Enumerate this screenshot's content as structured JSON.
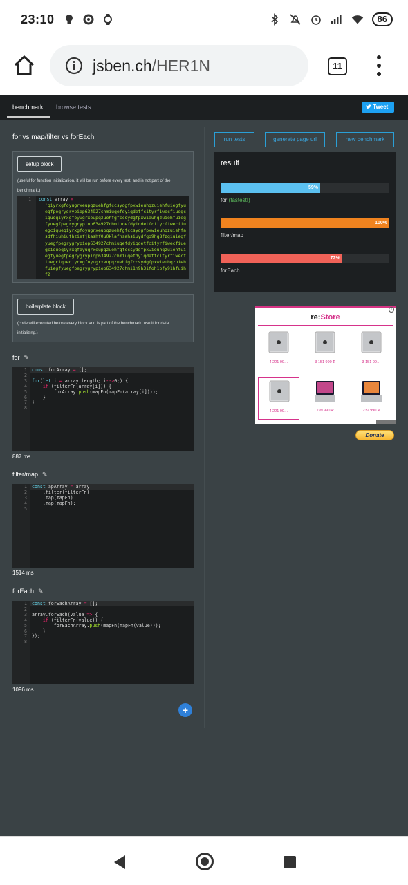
{
  "status_bar": {
    "time": "23:10",
    "battery": "86",
    "icons": [
      "bulb-icon",
      "refresh-icon",
      "watch-icon",
      "bluetooth-icon",
      "mute-icon",
      "alarm-icon",
      "signal-icon",
      "wifi-icon"
    ]
  },
  "browser": {
    "url_domain": "jsben.ch",
    "url_path": "/HER1N",
    "tab_count": "11"
  },
  "topnav": {
    "tabs": [
      {
        "label": "benchmark",
        "active": true
      },
      {
        "label": "browse tests",
        "active": false
      }
    ],
    "tweet_label": "Tweet"
  },
  "title": "for vs map/filter vs forEach",
  "setup": {
    "button": "setup block",
    "note": "(useful for function initialization. it will be run before every test, and is not part of the benchmark.)",
    "line_numbers": "1",
    "first_line": "const array = ",
    "string_content": "'qiyrxgfoyugrxeupqzuehfgfccsydgfpxwieuhqzuiehfuiegfyuegfpegrygrypiop634927chmiuqefdyiqdetfcityrfiwecfiuegciqueqiyrxgfoyugrxeupqzuehfgfccsydgfpxwieuhqzuiehfuiegfyuegfpegrygrypiop634927chmiuqefdyiqdetfcityrfiwecfiuegciqueqiyrxgfoyugrxeupqzuehfgfccsydgfpxwieuhqzuiehfasdfhiuhiufhziefjkashf0u0klafnsahsiuydfgo9hg8fzgiuiegfyuegfpegrygrypiop634927chmiuqefdyiqdetfcityrfiwecfiuegciqueqiyrxgfoyugrxeupqzuehfgfccsydgfpxwieuhqzuiehfuiegfyuegfpegrygrypiop634927chmiuqefdyiqdetfcityrfiwecfiuegciqueqiyrxgfoyugrxeupqzuehfgfccsydgfpxwieuhqzuiehfuiegfyuegfpegrygrypiop634927chmi1h9h3ifoh1pfy91hfuihf2"
  },
  "boilerplate": {
    "button": "boilerplate block",
    "note": "(code will executed before every block and is part of the benchmark. use it for data initializing.)"
  },
  "tests": [
    {
      "label": "for",
      "lines": "1\n2\n3\n4\n5\n6\n7\n8",
      "time": "887 ms"
    },
    {
      "label": "filter/map",
      "lines": "1\n2\n3\n4\n5",
      "time": "1514 ms"
    },
    {
      "label": "forEach",
      "lines": "1\n2\n3\n4\n5\n6\n7\n8",
      "time": "1096 ms"
    }
  ],
  "add_button": "+",
  "actions": {
    "run": "run tests",
    "generate": "generate page url",
    "new": "new benchmark"
  },
  "result": {
    "title": "result",
    "bars": [
      {
        "name": "for",
        "suffix": "(fastest!)",
        "percent": 59,
        "percent_label": "59%",
        "color": "#5bc0f0"
      },
      {
        "name": "filter/map",
        "suffix": "",
        "percent": 100,
        "percent_label": "100%",
        "color": "#f0831f"
      },
      {
        "name": "forEach",
        "suffix": "",
        "percent": 72,
        "percent_label": "72%",
        "color": "#f06258"
      }
    ]
  },
  "ad": {
    "logo_prefix": "re:",
    "logo_store": "Store",
    "info_glyph": "i",
    "products": [
      {
        "price": "4 221 99…",
        "kind": "mac-pro"
      },
      {
        "price": "3 151 990 ₽",
        "kind": "mac-pro"
      },
      {
        "price": "3 151 99…",
        "kind": "mac-pro"
      },
      {
        "price": "4 221 99…",
        "kind": "mac-pro"
      },
      {
        "price": "199 990 ₽",
        "kind": "macbook"
      },
      {
        "price": "232 990 ₽",
        "kind": "macbook"
      }
    ]
  },
  "donate": "Donate",
  "colors": {
    "accent": "#2a9fd6",
    "page_bg": "#3a4245",
    "dark_panel": "#1c1f21",
    "ad_brand": "#d6338b"
  }
}
